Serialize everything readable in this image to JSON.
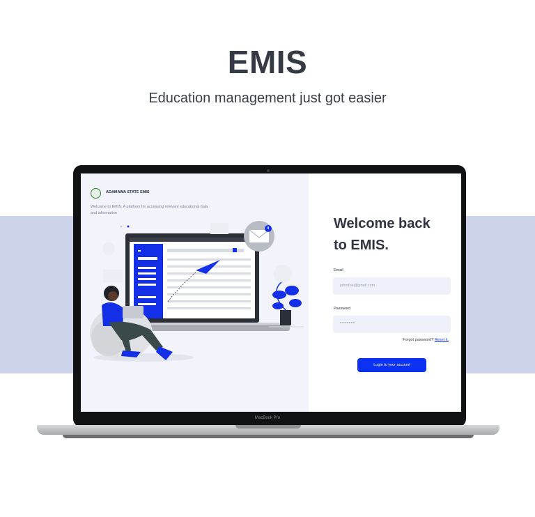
{
  "hero": {
    "title": "EMIS",
    "subtitle": "Education management just got easier"
  },
  "device": {
    "model_label": "MacBook Pro"
  },
  "app": {
    "logo_text": "ADAMAWA STATE EMIS",
    "tagline": "Welcome to EMIS. A platform for accessing relevant educational data and information",
    "login": {
      "heading_line1": "Welcome back",
      "heading_line2": "to EMIS.",
      "email_label": "Email",
      "email_placeholder": "johndoe@gmail.com",
      "password_label": "Password",
      "password_value": "*******",
      "forgot_text": "Forgot password?",
      "reset_link": "Reset it.",
      "submit_label": "Login to your account"
    }
  },
  "colors": {
    "band": "#cdd3eb",
    "primary": "#0a32f0",
    "input_bg": "#eef0fa"
  }
}
